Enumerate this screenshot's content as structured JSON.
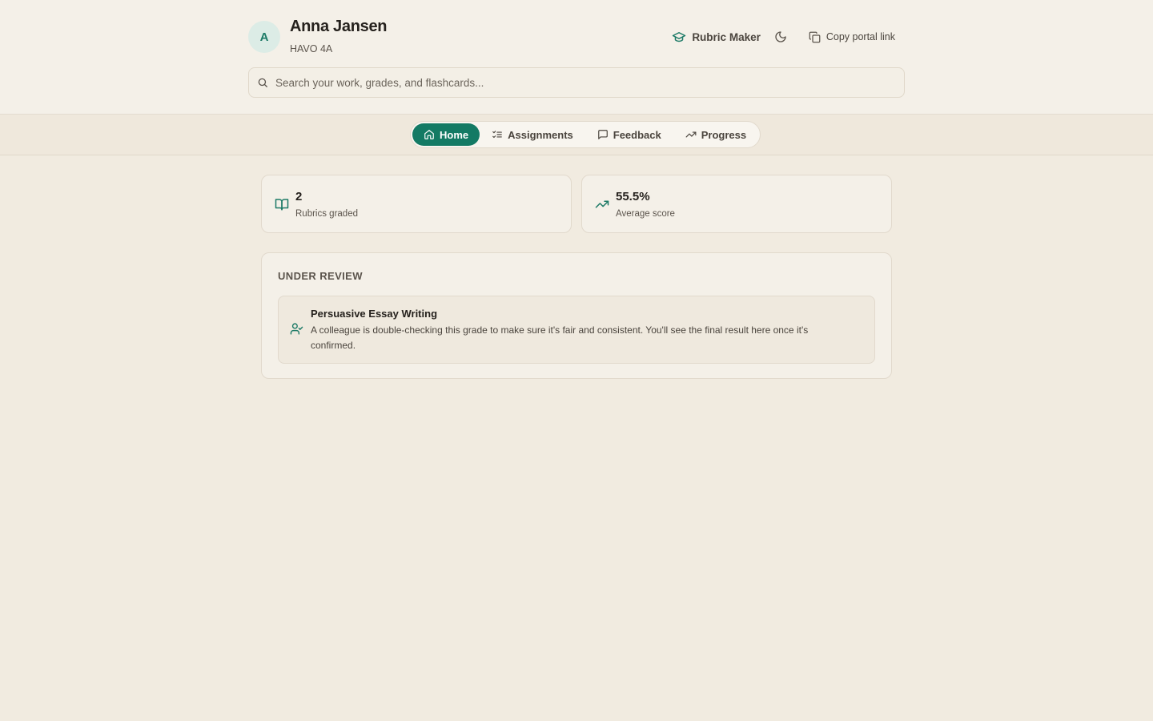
{
  "student": {
    "initial": "A",
    "name": "Anna Jansen",
    "class": "HAVO 4A"
  },
  "header": {
    "brand_label": "Rubric Maker",
    "brand_icon": "graduation-cap-icon",
    "theme_icon": "moon-icon",
    "copy_label": "Copy portal link",
    "copy_icon": "copy-icon"
  },
  "search": {
    "placeholder": "Search your work, grades, and flashcards...",
    "value": ""
  },
  "nav": {
    "tabs": [
      {
        "label": "Home",
        "icon": "home-icon",
        "active": true
      },
      {
        "label": "Assignments",
        "icon": "list-checks-icon",
        "active": false
      },
      {
        "label": "Feedback",
        "icon": "message-square-icon",
        "active": false
      },
      {
        "label": "Progress",
        "icon": "trending-up-icon",
        "active": false
      }
    ]
  },
  "stats": [
    {
      "value": "2",
      "label": "Rubrics graded",
      "icon": "book-open-icon"
    },
    {
      "value": "55.5%",
      "label": "Average score",
      "icon": "trending-up-icon"
    }
  ],
  "review": {
    "heading": "UNDER REVIEW",
    "items": [
      {
        "title": "Persuasive Essay Writing",
        "description": "A colleague is double-checking this grade to make sure it's fair and consistent. You'll see the final result here once it's confirmed.",
        "icon": "user-check-icon"
      }
    ]
  },
  "colors": {
    "accent": "#137a64",
    "background": "#f1ebe0",
    "card": "#f4f0e8"
  }
}
